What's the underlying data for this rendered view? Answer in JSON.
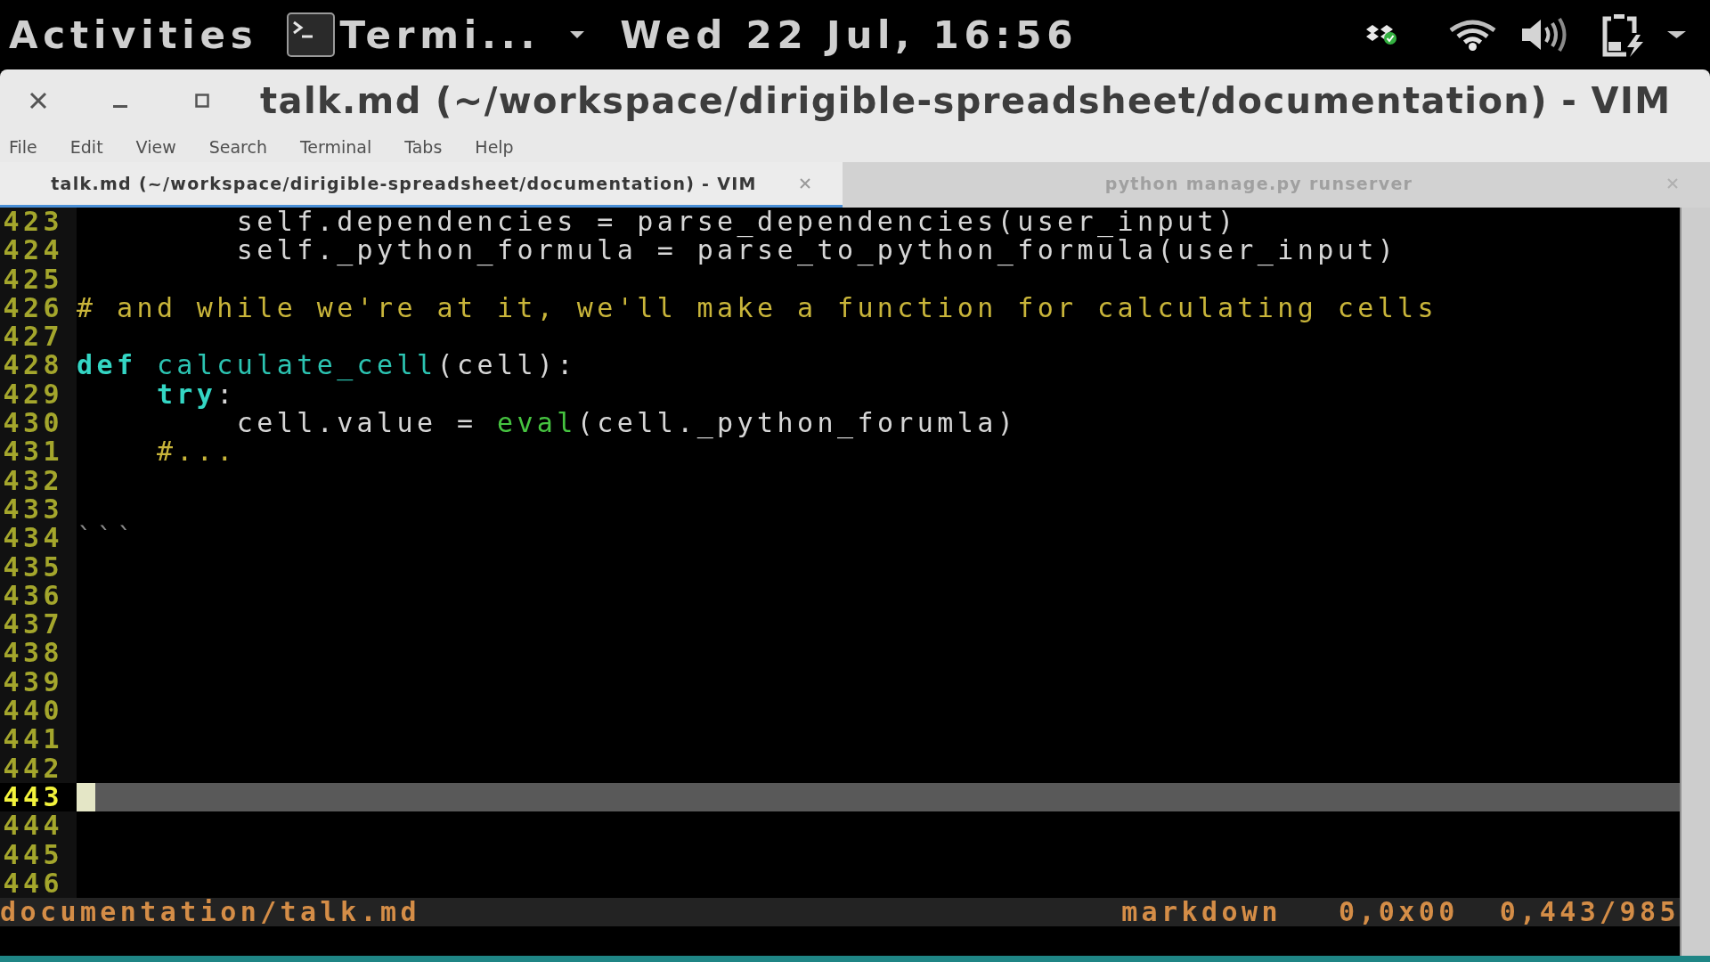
{
  "top_bar": {
    "activities": "Activities",
    "app_menu": "Termi...",
    "clock": "Wed 22 Jul, 16:56"
  },
  "window": {
    "title": "talk.md (~/workspace/dirigible-spreadsheet/documentation) - VIM",
    "menu": [
      "File",
      "Edit",
      "View",
      "Search",
      "Terminal",
      "Tabs",
      "Help"
    ]
  },
  "tabs": [
    {
      "label": "talk.md (~/workspace/dirigible-spreadsheet/documentation) - VIM",
      "selected": true
    },
    {
      "label": "python manage.py runserver",
      "selected": false
    }
  ],
  "editor": {
    "lines": [
      {
        "number": "423",
        "current": false,
        "segments": [
          {
            "kind": "plain",
            "text": "        self.dependencies = parse_dependencies(user_input)"
          }
        ]
      },
      {
        "number": "424",
        "current": false,
        "segments": [
          {
            "kind": "plain",
            "text": "        self._python_formula = parse_to_python_formula(user_input)"
          }
        ]
      },
      {
        "number": "425",
        "current": false
      },
      {
        "number": "426",
        "current": false,
        "segments": [
          {
            "kind": "comment",
            "text": "# and while we're at it, we'll make a function for calculating cells"
          }
        ]
      },
      {
        "number": "427",
        "current": false
      },
      {
        "number": "428",
        "current": false,
        "segments": [
          {
            "kind": "keyword",
            "text": "def"
          },
          {
            "kind": "function",
            "text": " calculate_cell"
          },
          {
            "kind": "plain",
            "text": "(cell):"
          }
        ]
      },
      {
        "number": "429",
        "current": false,
        "segments": [
          {
            "kind": "keyword",
            "text": "    try"
          },
          {
            "kind": "plain",
            "text": ":"
          }
        ]
      },
      {
        "number": "430",
        "current": false,
        "segments": [
          {
            "kind": "plain",
            "text": "        cell.value = "
          },
          {
            "kind": "builtin",
            "text": "eval"
          },
          {
            "kind": "plain",
            "text": "(cell._python_forumla)"
          }
        ]
      },
      {
        "number": "431",
        "current": false,
        "segments": [
          {
            "kind": "comment",
            "text": "    #..."
          }
        ]
      },
      {
        "number": "432",
        "current": false
      },
      {
        "number": "433",
        "current": false
      },
      {
        "number": "434",
        "current": false,
        "segments": [
          {
            "kind": "delimiter",
            "text": "```"
          }
        ]
      },
      {
        "number": "435",
        "current": false
      },
      {
        "number": "436",
        "current": false
      },
      {
        "number": "437",
        "current": false
      },
      {
        "number": "438",
        "current": false
      },
      {
        "number": "439",
        "current": false
      },
      {
        "number": "440",
        "current": false
      },
      {
        "number": "441",
        "current": false
      },
      {
        "number": "442",
        "current": false
      },
      {
        "number": "443",
        "current": true
      },
      {
        "number": "444",
        "current": false
      },
      {
        "number": "445",
        "current": false
      },
      {
        "number": "446",
        "current": false
      }
    ]
  },
  "status_bar": {
    "file": "documentation/talk.md",
    "fields": [
      "markdown",
      "0,0x00",
      "0,443/985"
    ]
  }
}
